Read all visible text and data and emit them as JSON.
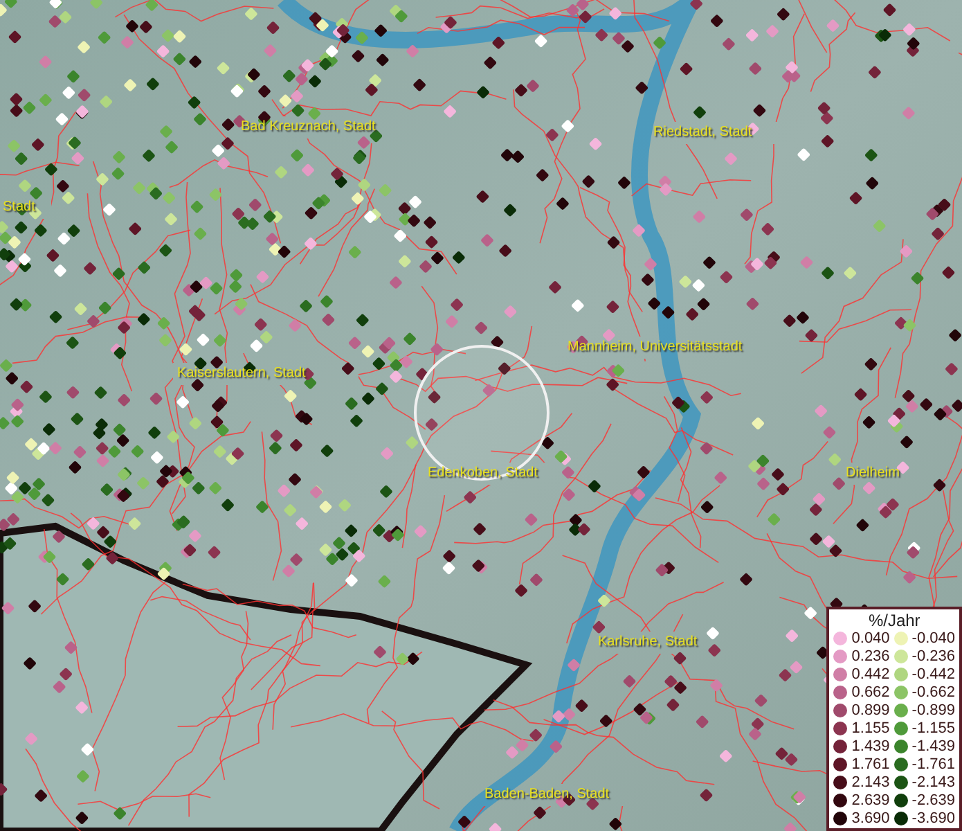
{
  "map": {
    "places": [
      {
        "name": "Bad Kreuznach, Stadt"
      },
      {
        "name": "Riedstadt, Stadt"
      },
      {
        "name": "Stadt"
      },
      {
        "name": "Kaiserslautern, Stadt"
      },
      {
        "name": "Mannheim, Universitätsstadt"
      },
      {
        "name": "Edenkoben, Stadt"
      },
      {
        "name": "Dielheim"
      },
      {
        "name": "Karlsruhe, Stadt"
      },
      {
        "name": "Baden-Baden, Stadt"
      }
    ]
  },
  "legend": {
    "title": "%/Jahr",
    "positive": [
      {
        "value": "0.040",
        "color": "#f4b6dc"
      },
      {
        "value": "0.236",
        "color": "#e49ac4"
      },
      {
        "value": "0.442",
        "color": "#d07ea6"
      },
      {
        "value": "0.662",
        "color": "#b9628a"
      },
      {
        "value": "0.899",
        "color": "#a04a6c"
      },
      {
        "value": "1.155",
        "color": "#8c3450"
      },
      {
        "value": "1.439",
        "color": "#74233a"
      },
      {
        "value": "1.761",
        "color": "#5e1526"
      },
      {
        "value": "2.143",
        "color": "#470d19"
      },
      {
        "value": "2.639",
        "color": "#330810"
      },
      {
        "value": "3.690",
        "color": "#220509"
      }
    ],
    "negative": [
      {
        "value": "-0.040",
        "color": "#eef3b4"
      },
      {
        "value": "-0.236",
        "color": "#cde69a"
      },
      {
        "value": "-0.442",
        "color": "#afd680"
      },
      {
        "value": "-0.662",
        "color": "#8cc466"
      },
      {
        "value": "-0.899",
        "color": "#6aaf4c"
      },
      {
        "value": "-1.155",
        "color": "#4f9a3a"
      },
      {
        "value": "-1.439",
        "color": "#3b842c"
      },
      {
        "value": "-1.761",
        "color": "#2a6c20"
      },
      {
        "value": "-2.143",
        "color": "#1c5414"
      },
      {
        "value": "-2.639",
        "color": "#113f0c"
      },
      {
        "value": "-3.690",
        "color": "#0a2c07"
      }
    ]
  }
}
